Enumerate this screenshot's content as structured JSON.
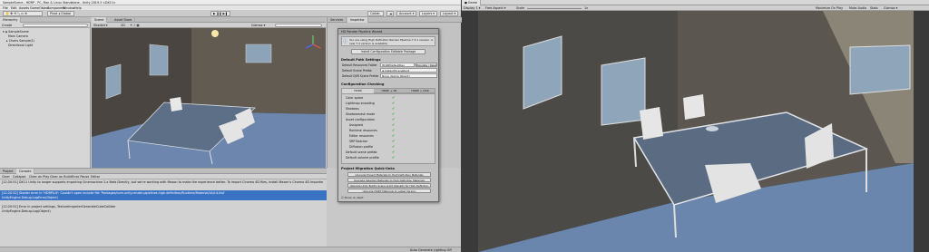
{
  "window": {
    "title": "SampleScene - HDRP - PC, Mac & Linux Standalone - Unity 2019.3 <DX11>"
  },
  "menu": [
    "File",
    "Edit",
    "Assets",
    "GameObject",
    "Component",
    "Window",
    "Help"
  ],
  "toolbar": {
    "collab": "Collab",
    "account": "Account",
    "layers": "Layers",
    "layout": "Layout"
  },
  "scene_tabs": [
    "Scene",
    "Asset Store"
  ],
  "scene_toolbar": {
    "shading": "Shaded",
    "mode": "2D",
    "gizmos": "Gizmos",
    "search": "All"
  },
  "hierarchy": {
    "tab": "Hierarchy",
    "create": "Create",
    "search": "All",
    "items": [
      "SampleScene",
      "Main Camera",
      "Directional Light",
      "Chairs Sample(1)",
      "Directional Light"
    ]
  },
  "project": {
    "tabs": [
      "Project",
      "Console"
    ],
    "toolbar": [
      "Clear",
      "Collapse",
      "Clear on Play",
      "Clear on Build",
      "Error Pause",
      "Editor"
    ],
    "log_lines": [
      "[12:20:51] DX11 Unity to longer supports importing Cinemachine 2.x Beta Directly, but we're working with Maxon to make the experience better. To import Cinema 4D files, install Maxon's Cinema 4D Importer.",
      "[12:20:51] Error in project settings, TextureImporterGenerateCubeCollider",
      "UnityEngine.Debug:Log(Object)"
    ],
    "selected_lines": [
      "[12:20:52] Shader error in 'HDRP/Lit': Couldn't open include file 'Packages/com.unity.render-pipelines.high-definition/Runtime/Material/Lit/Lit.hlsl'",
      "UnityEngine.Debug:LogError(Object)"
    ]
  },
  "inspector": {
    "tabs": [
      "Services",
      "Inspector"
    ]
  },
  "wizard": {
    "title": "HD Render Pipeline Wizard",
    "info": "You are using High Definition Render Pipeline 7.3.1 version. A new 7.4 version is available.",
    "install_button": "Install Configuration Editable Package",
    "default_path_heading": "Default Path Settings",
    "paths": [
      {
        "label": "Default Resources Folder",
        "value": "HDRPDefaultRes",
        "button": "Populate / Reset"
      },
      {
        "label": "Default Scene Prefab",
        "value": "DefaultSceneRoot"
      },
      {
        "label": "Default DXR Scene Prefab",
        "value": "None (Game Object)"
      }
    ],
    "config_heading": "Configuration Checking",
    "config_tabs": [
      "HDRP",
      "HDRP + VR",
      "HDRP + DXR"
    ],
    "checks": [
      "Color space",
      "Lightmap encoding",
      "Shadows",
      "Shadowmask mode",
      "Asset configuration",
      "Assigned",
      "Runtime resources",
      "Editor resources",
      "SRP Batcher",
      "Diffusion profile",
      "Default scene prefab",
      "Default volume profile"
    ],
    "fix_all": "Fix All",
    "migration_heading": "Project Migration Quick-links",
    "migration_buttons": [
      "Upgrade Project Materials to High Definition Materials",
      "Upgrade Selected Materials to High Definition Materials",
      "Upgrade Unity Builtin Scene Light Intensity for High Definition",
      "Upgrade HDRP Materials to Latest Version"
    ],
    "show_on_start": "Show on start"
  },
  "status": {
    "left": "Auto Generate Lighting Off"
  },
  "game": {
    "tab": "Game",
    "display": "Display 1",
    "aspect": "Free Aspect",
    "scale_label": "Scale",
    "scale_value": "1x",
    "maximize": "Maximize On Play",
    "mute": "Mute Audio",
    "stats": "Stats",
    "gizmos": "Gizmos"
  },
  "colors": {
    "accent_blue": "#3a72c4",
    "check_green": "#3aa33a"
  }
}
